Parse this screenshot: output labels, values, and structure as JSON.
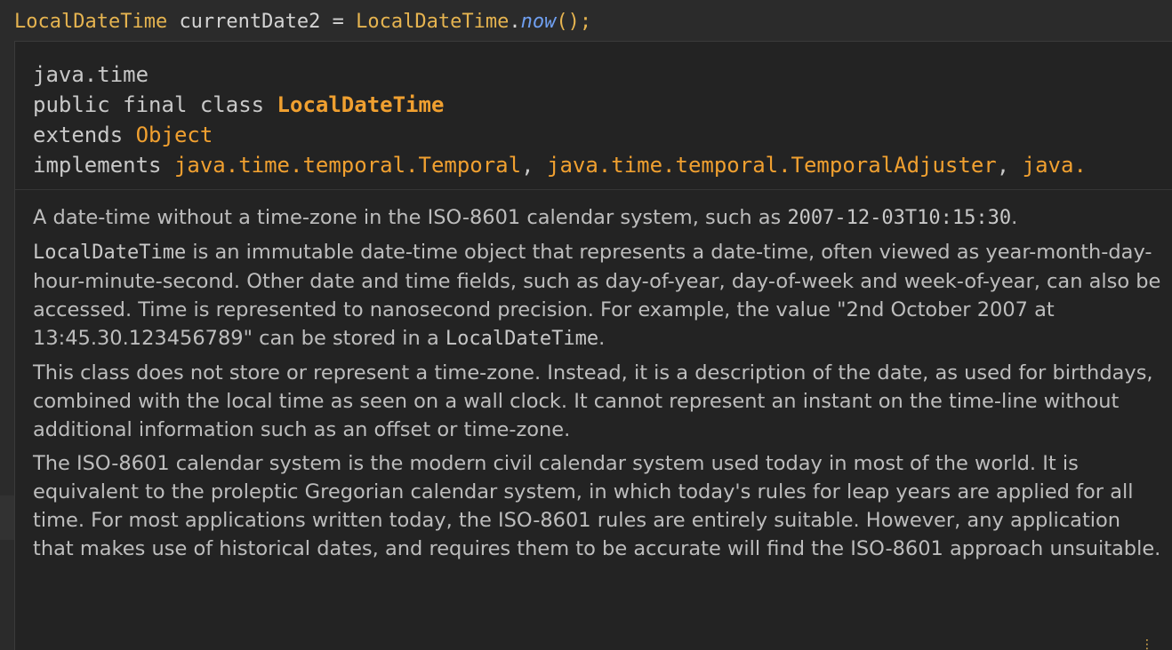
{
  "editor": {
    "code_tokens": {
      "type": "LocalDateTime",
      "space1": " ",
      "var": "currentDate2",
      "eq": " = ",
      "cls": "LocalDateTime",
      "dot": ".",
      "method": "now",
      "parens": "();"
    }
  },
  "doc": {
    "package": "java.time",
    "decl_prefix": "public final class ",
    "class_name": "LocalDateTime",
    "extends_prefix": "extends ",
    "extends_name": "Object",
    "implements_prefix": "implements ",
    "implements_1": "java.time.temporal.Temporal",
    "sep_1": ", ",
    "implements_2": "java.time.temporal.TemporalAdjuster",
    "sep_2": ", ",
    "implements_3": "java.",
    "p1_text": "A date-time without a time-zone in the ISO-8601 calendar system, such as ",
    "p1_code": "2007-12-03T10:15:30",
    "p1_end": ".",
    "p2_code": "LocalDateTime",
    "p2_text": " is an immutable date-time object that represents a date-time, often viewed as year-month-day-hour-minute-second. Other date and time fields, such as day-of-year, day-of-week and week-of-year, can also be accessed. Time is represented to nanosecond precision. For example, the value \"2nd October 2007 at 13:45.30.123456789\" can be stored in a ",
    "p2_code2": "LocalDateTime",
    "p2_end": ".",
    "p3": "This class does not store or represent a time-zone. Instead, it is a description of the date, as used for birthdays, combined with the local time as seen on a wall clock. It cannot represent an instant on the time-line without additional information such as an offset or time-zone.",
    "p4": "The ISO-8601 calendar system is the modern civil calendar system used today in most of the world. It is equivalent to the proleptic Gregorian calendar system, in which today's rules for leap years are applied for all time. For most applications written today, the ISO-8601 rules are entirely suitable. However, any application that makes use of historical dates, and requires them to be accurate will find the ISO-8601 approach unsuitable."
  },
  "colors": {
    "background": "#2b2b2b",
    "popup_background": "#232323",
    "type_name": "#e6b450",
    "method_call": "#6f9ff0",
    "doc_accent": "#f0a030",
    "doc_text": "#bdbdbd"
  }
}
